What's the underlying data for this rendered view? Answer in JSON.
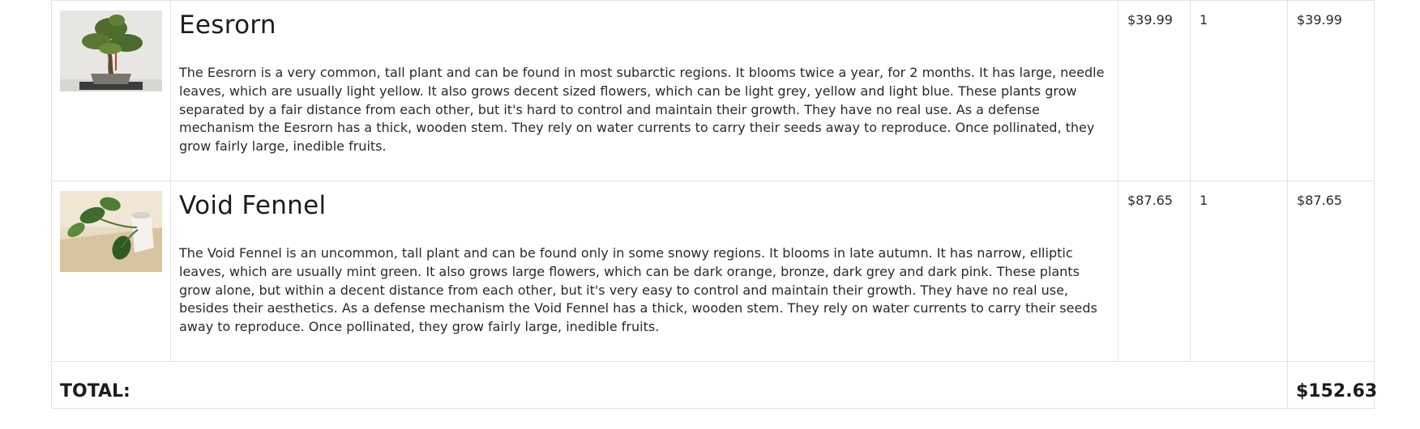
{
  "cart": {
    "items": [
      {
        "name": "Eesrorn",
        "description": "The Eesrorn is a very common, tall plant and can be found in most subarctic regions. It blooms twice a year, for 2 months. It has large, needle leaves, which are usually light yellow. It also grows decent sized flowers, which can be light grey, yellow and light blue. These plants grow separated by a fair distance from each other, but it's hard to control and maintain their growth. They have no real use. As a defense mechanism the Eesrorn has a thick, wooden stem. They rely on water currents to carry their seeds away to reproduce. Once pollinated, they grow fairly large, inedible fruits.",
        "price": "$39.99",
        "quantity": "1",
        "total": "$39.99",
        "image": "bonsai-tree-photo"
      },
      {
        "name": "Void Fennel",
        "description": "The Void Fennel is an uncommon, tall plant and can be found only in some snowy regions. It blooms in late autumn. It has narrow, elliptic leaves, which are usually mint green. It also grows large flowers, which can be dark orange, bronze, dark grey and dark pink. These plants grow alone, but within a decent distance from each other, but it's very easy to control and maintain their growth. They have no real use, besides their aesthetics. As a defense mechanism the Void Fennel has a thick, wooden stem. They rely on water currents to carry their seeds away to reproduce. Once pollinated, they grow fairly large, inedible fruits.",
        "price": "$87.65",
        "quantity": "1",
        "total": "$87.65",
        "image": "potted-pothos-photo"
      }
    ],
    "total_label": "TOTAL:",
    "total_value": "$152.63"
  }
}
